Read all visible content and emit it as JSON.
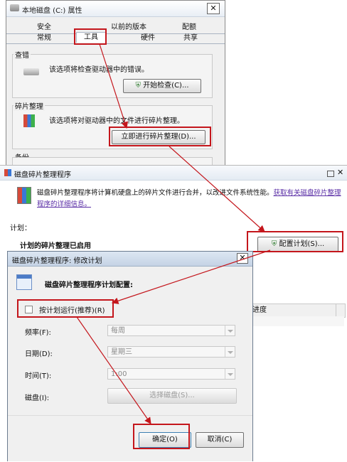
{
  "props_window": {
    "title": "本地磁盘 (C:) 属性",
    "close": "✕",
    "tabs_top": [
      "安全",
      "以前的版本",
      "配额"
    ],
    "tabs_bottom": [
      "常规",
      "工具",
      "硬件",
      "共享"
    ],
    "check": {
      "group": "查错",
      "desc": "该选项将检查驱动器中的错误。",
      "button": "开始检查(C)..."
    },
    "defrag": {
      "group": "碎片整理",
      "desc": "该选项将对驱动器中的文件进行碎片整理。",
      "button": "立即进行碎片整理(D)..."
    },
    "backup_group": "备份"
  },
  "defrag_window": {
    "title": "磁盘碎片整理程序",
    "close": "✕",
    "desc": "磁盘碎片整理程序将计算机硬盘上的碎片文件进行合并，以改进文件系统性能。",
    "link_part1": "获取有关磁盘碎片整理",
    "link_part2": "程序的详细信息。",
    "schedule_label": "计划：",
    "schedule_status": "计划的碎片整理已启用",
    "config_button": "配置计划(S)...",
    "column_progress": "进度"
  },
  "schedule_dialog": {
    "title": "磁盘碎片整理程序: 修改计划",
    "close": "✕",
    "heading": "磁盘碎片整理程序计划配置:",
    "run_on_schedule": "按计划运行(推荐)(R)",
    "frequency_label": "频率(F):",
    "frequency_value": "每周",
    "day_label": "日期(D):",
    "day_value": "星期三",
    "time_label": "时间(T):",
    "time_value": "1:00",
    "disk_label": "磁盘(I):",
    "disk_button": "选择磁盘(S)...",
    "ok_button": "确定(O)",
    "cancel_button": "取消(C)"
  },
  "colors": {
    "highlight_red": "#c4161c",
    "link_purple": "#5a2ea6",
    "dialog_bg": "#f0f0f0"
  },
  "icons": [
    "drive-icon",
    "shield-icon",
    "defrag-icon",
    "calendar-icon",
    "close-icon"
  ]
}
